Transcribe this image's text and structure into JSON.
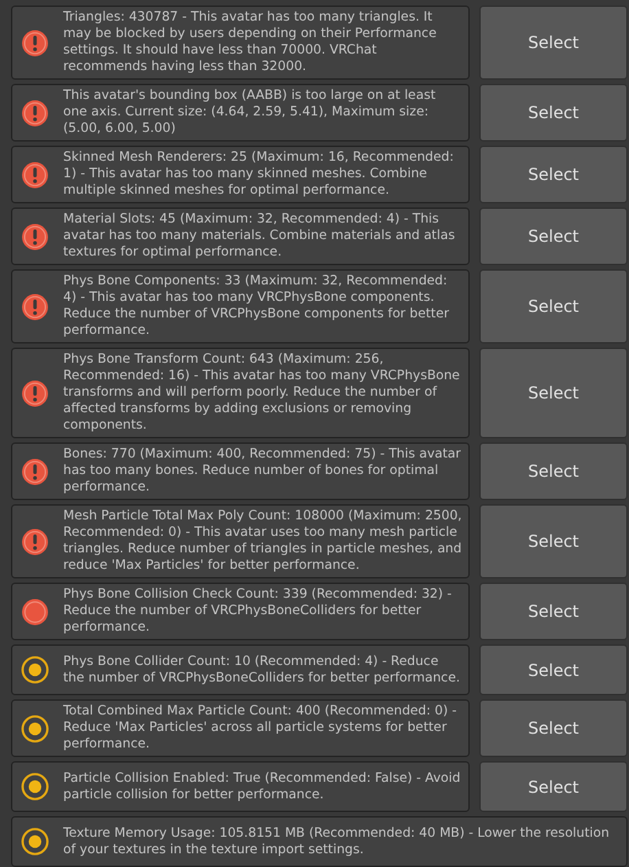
{
  "issues": [
    {
      "kind": "error",
      "message": "Triangles: 430787 - This avatar has too many triangles. It may be blocked by users depending on their Performance settings. It should have less than 70000. VRChat recommends having less than 32000.",
      "button": "Select"
    },
    {
      "kind": "error",
      "message": "This avatar's bounding box (AABB) is too large on at least one axis. Current size: (4.64, 2.59, 5.41), Maximum size: (5.00, 6.00, 5.00)",
      "button": "Select"
    },
    {
      "kind": "error",
      "message": "Skinned Mesh Renderers: 25 (Maximum: 16, Recommended: 1) - This avatar has too many skinned meshes. Combine multiple skinned meshes for optimal performance.",
      "button": "Select"
    },
    {
      "kind": "error",
      "message": "Material Slots: 45 (Maximum: 32, Recommended: 4) - This avatar has too many materials. Combine materials and atlas textures for optimal performance.",
      "button": "Select"
    },
    {
      "kind": "error",
      "message": "Phys Bone Components: 33 (Maximum: 32, Recommended: 4) - This avatar has too many VRCPhysBone components. Reduce the number of VRCPhysBone components for better performance.",
      "button": "Select"
    },
    {
      "kind": "error",
      "message": "Phys Bone Transform Count: 643 (Maximum: 256, Recommended: 16) - This avatar has too many VRCPhysBone transforms and will perform poorly. Reduce the number of affected transforms by adding exclusions or removing components.",
      "button": "Select"
    },
    {
      "kind": "error",
      "message": "Bones: 770 (Maximum: 400, Recommended: 75) - This avatar has too many bones. Reduce number of bones for optimal performance.",
      "button": "Select"
    },
    {
      "kind": "error",
      "message": "Mesh Particle Total Max Poly Count: 108000 (Maximum: 2500, Recommended: 0) - This avatar uses too many mesh particle triangles. Reduce number of triangles in particle meshes, and reduce 'Max Particles' for better performance.",
      "button": "Select"
    },
    {
      "kind": "poor",
      "message": "Phys Bone Collision Check Count: 339 (Recommended: 32) - Reduce the number of VRCPhysBoneColliders for better performance.",
      "button": "Select"
    },
    {
      "kind": "warning",
      "message": "Phys Bone Collider Count: 10 (Recommended: 4) - Reduce the number of VRCPhysBoneColliders for better performance.",
      "button": "Select"
    },
    {
      "kind": "warning",
      "message": "Total Combined Max Particle Count: 400 (Recommended: 0) - Reduce 'Max Particles' across all particle systems for better performance.",
      "button": "Select"
    },
    {
      "kind": "warning",
      "message": "Particle Collision Enabled: True (Recommended: False) - Avoid particle collision for better performance.",
      "button": "Select"
    },
    {
      "kind": "warning",
      "message": "Texture Memory Usage: 105.8151 MB (Recommended: 40 MB) - Lower the resolution of your textures in the texture import settings."
    }
  ]
}
